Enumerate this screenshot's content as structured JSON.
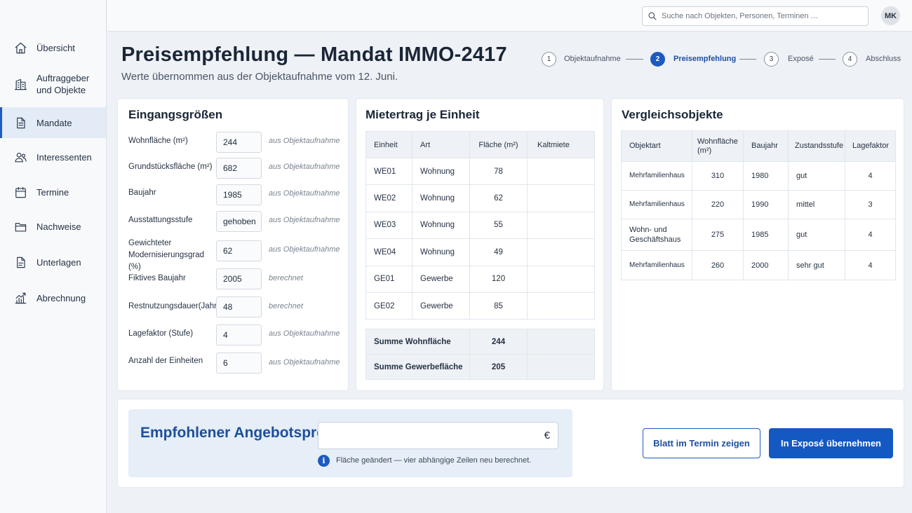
{
  "sidebar": {
    "items": [
      {
        "label": "Übersicht",
        "icon": "home-icon"
      },
      {
        "label": "Auftraggeber und Objekte",
        "icon": "building-icon"
      },
      {
        "label": "Mandate",
        "icon": "document-icon",
        "active": true
      },
      {
        "label": "Interessenten",
        "icon": "users-icon"
      },
      {
        "label": "Termine",
        "icon": "calendar-icon"
      },
      {
        "label": "Nachweise",
        "icon": "folder-icon"
      },
      {
        "label": "Unterlagen",
        "icon": "file-icon"
      },
      {
        "label": "Abrechnung",
        "icon": "chart-icon"
      }
    ]
  },
  "topbar": {
    "search_placeholder": "Suche nach Objekten, Personen, Terminen …",
    "avatar_initials": "MK"
  },
  "header": {
    "title": "Preisempfehlung — Mandat IMMO-2417",
    "subtitle": "Werte übernommen aus der Objektaufnahme vom 12. Juni."
  },
  "stepper": {
    "steps": [
      {
        "number": "1",
        "label": "Objektaufnahme"
      },
      {
        "number": "2",
        "label": "Preisempfehlung",
        "active": true
      },
      {
        "number": "3",
        "label": "Exposé"
      },
      {
        "number": "4",
        "label": "Abschluss"
      }
    ]
  },
  "inputs": {
    "title": "Eingangsgrößen",
    "fields": [
      {
        "label": "Wohnfläche (m²)",
        "value": "244",
        "source": "aus Objektaufnahme"
      },
      {
        "label": "Grundstücksfläche (m²)",
        "value": "682",
        "source": "aus Objektaufnahme"
      },
      {
        "label": "Baujahr",
        "value": "1985",
        "source": "aus Objektaufnahme"
      },
      {
        "label": "Ausstattungsstufe",
        "value": "gehoben",
        "source": "aus Objektaufnahme"
      },
      {
        "label": "Gewichteter Modernisierungsgrad (%)",
        "value": "62",
        "source": "aus Objektaufnahme"
      },
      {
        "label": "Fiktives Baujahr",
        "value": "2005",
        "source": "berechnet"
      },
      {
        "label": "Restnutzungsdauer(Jahre)",
        "value": "48",
        "source": "berechnet"
      },
      {
        "label": "Lagefaktor (Stufe)",
        "value": "4",
        "source": "aus Objektaufnahme"
      },
      {
        "label": "Anzahl der Einheiten",
        "value": "6",
        "source": "aus Objektaufnahme"
      }
    ]
  },
  "rent": {
    "title": "Mietertrag je Einheit",
    "headers": [
      "Einheit",
      "Art",
      "Fläche (m²)",
      "Kaltmiete"
    ],
    "rows": [
      {
        "unit": "WE01",
        "type": "Wohnung",
        "area": "78",
        "rent": ""
      },
      {
        "unit": "WE02",
        "type": "Wohnung",
        "area": "62",
        "rent": ""
      },
      {
        "unit": "WE03",
        "type": "Wohnung",
        "area": "55",
        "rent": ""
      },
      {
        "unit": "WE04",
        "type": "Wohnung",
        "area": "49",
        "rent": ""
      },
      {
        "unit": "GE01",
        "type": "Gewerbe",
        "area": "120",
        "rent": ""
      },
      {
        "unit": "GE02",
        "type": "Gewerbe",
        "area": "85",
        "rent": ""
      }
    ],
    "sums": [
      {
        "label": "Summe Wohnfläche",
        "value": "244"
      },
      {
        "label": "Summe Gewerbefläche",
        "value": "205"
      }
    ]
  },
  "comparables": {
    "title": "Vergleichsobjekte",
    "headers": [
      "Objektart",
      "Wohnfläche (m²)",
      "Baujahr",
      "Zustandsstufe",
      "Lagefaktor"
    ],
    "rows": [
      {
        "type": "Mehrfamilienhaus",
        "area": "310",
        "year": "1980",
        "condition": "gut",
        "location": "4"
      },
      {
        "type": "Mehrfamilienhaus",
        "area": "220",
        "year": "1990",
        "condition": "mittel",
        "location": "3"
      },
      {
        "type": "Wohn- und Geschäftshaus",
        "area": "275",
        "year": "1985",
        "condition": "gut",
        "location": "4"
      },
      {
        "type": "Mehrfamilienhaus",
        "area": "260",
        "year": "2000",
        "condition": "sehr gut",
        "location": "4"
      }
    ]
  },
  "price": {
    "label": "Empfohlener Angebotspreis",
    "value": "",
    "currency": "€",
    "info": "Fläche geändert — vier abhängige Zeilen neu berechnet."
  },
  "actions": {
    "secondary": "Blatt im Termin zeigen",
    "primary": "In Exposé übernehmen"
  },
  "colors": {
    "accent": "#1d5bbf",
    "primary_button": "#1458c2",
    "price_box": "#e6eef8"
  }
}
